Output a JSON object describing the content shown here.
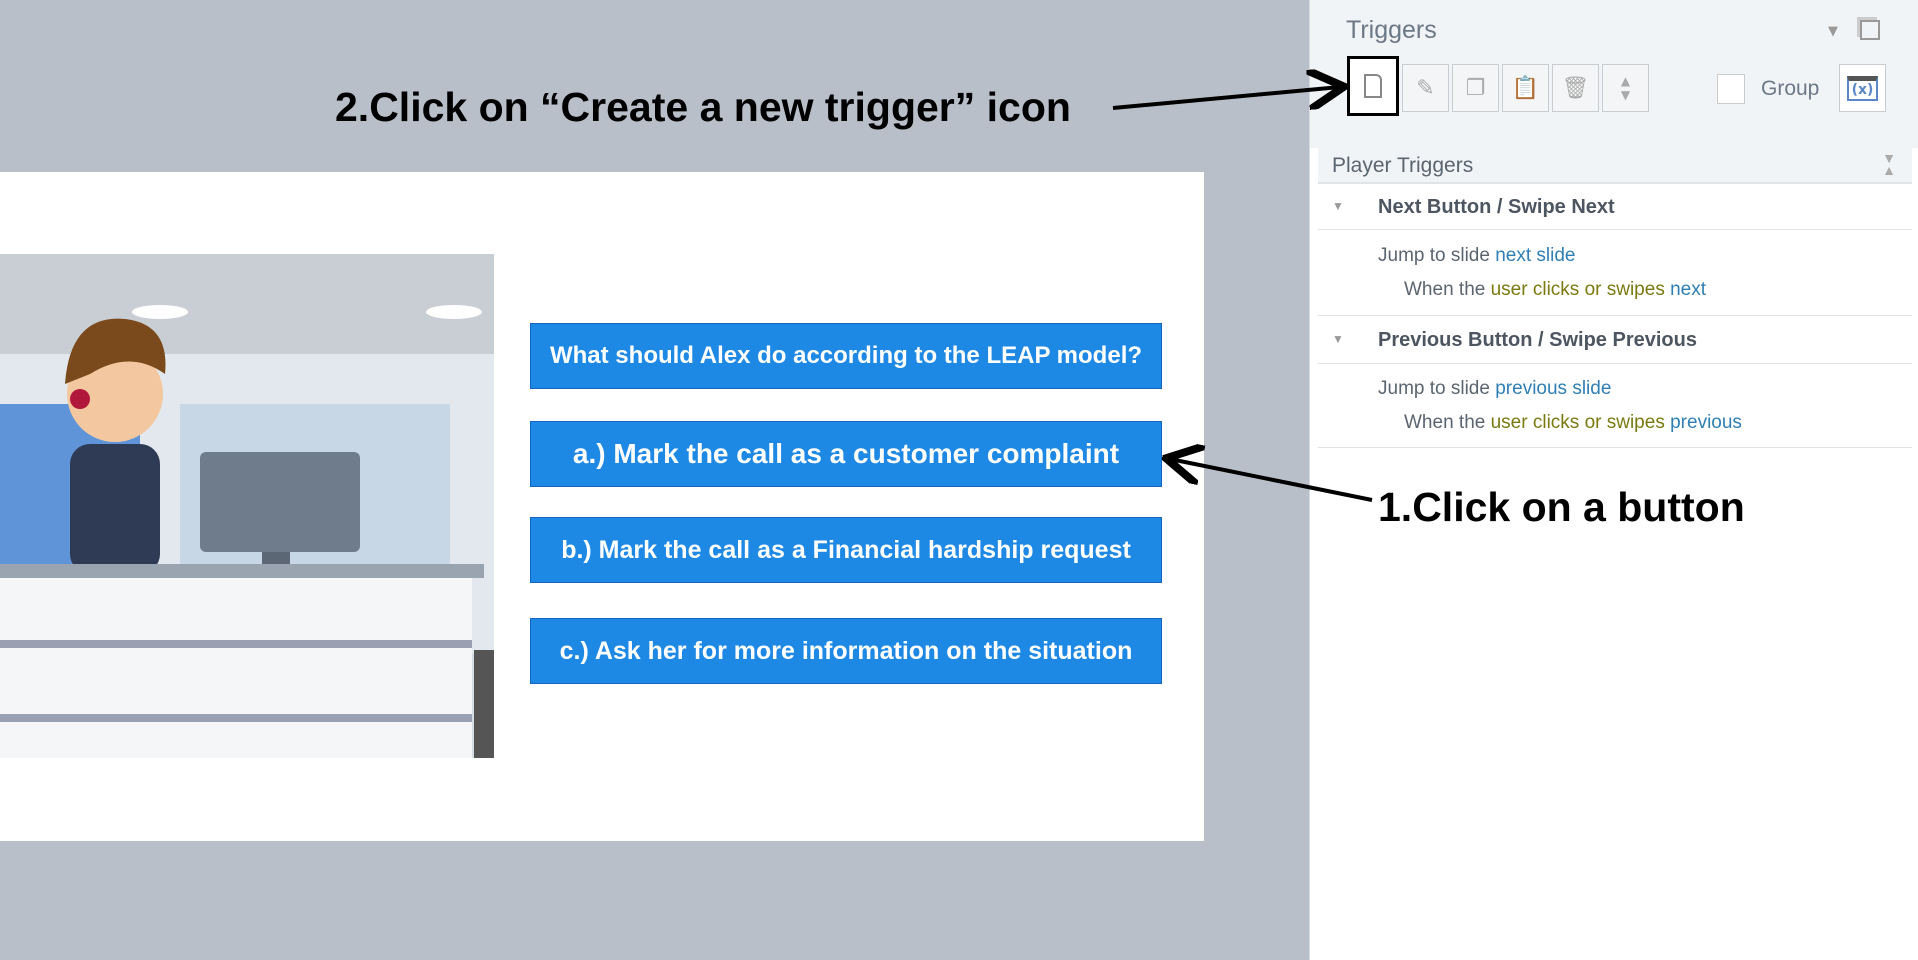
{
  "slide": {
    "question": "What should Alex do according to the LEAP model?",
    "options": [
      "a.) Mark the call as a customer complaint",
      "b.) Mark the call as a Financial hardship request",
      "c.) Ask her for more information on the situation"
    ]
  },
  "annotations": {
    "step2": "2.Click on “Create a new trigger” icon",
    "step1": "1.Click on a button"
  },
  "panel": {
    "title": "Triggers",
    "group_label": "Group",
    "variables_icon": "(x)",
    "section_title": "Player Triggers",
    "triggers": [
      {
        "name": "Next Button / Swipe Next",
        "action_prefix": "Jump to slide ",
        "action_target": "next slide",
        "cond_prefix": "When the ",
        "cond_mid": "user clicks or swipes ",
        "cond_target": "next"
      },
      {
        "name": "Previous Button / Swipe Previous",
        "action_prefix": "Jump to slide ",
        "action_target": "previous slide",
        "cond_prefix": "When the ",
        "cond_mid": "user clicks or swipes ",
        "cond_target": "previous"
      }
    ]
  },
  "colors": {
    "button": "#1e88e5",
    "link": "#2f7fb5",
    "event": "#7a7a10"
  }
}
